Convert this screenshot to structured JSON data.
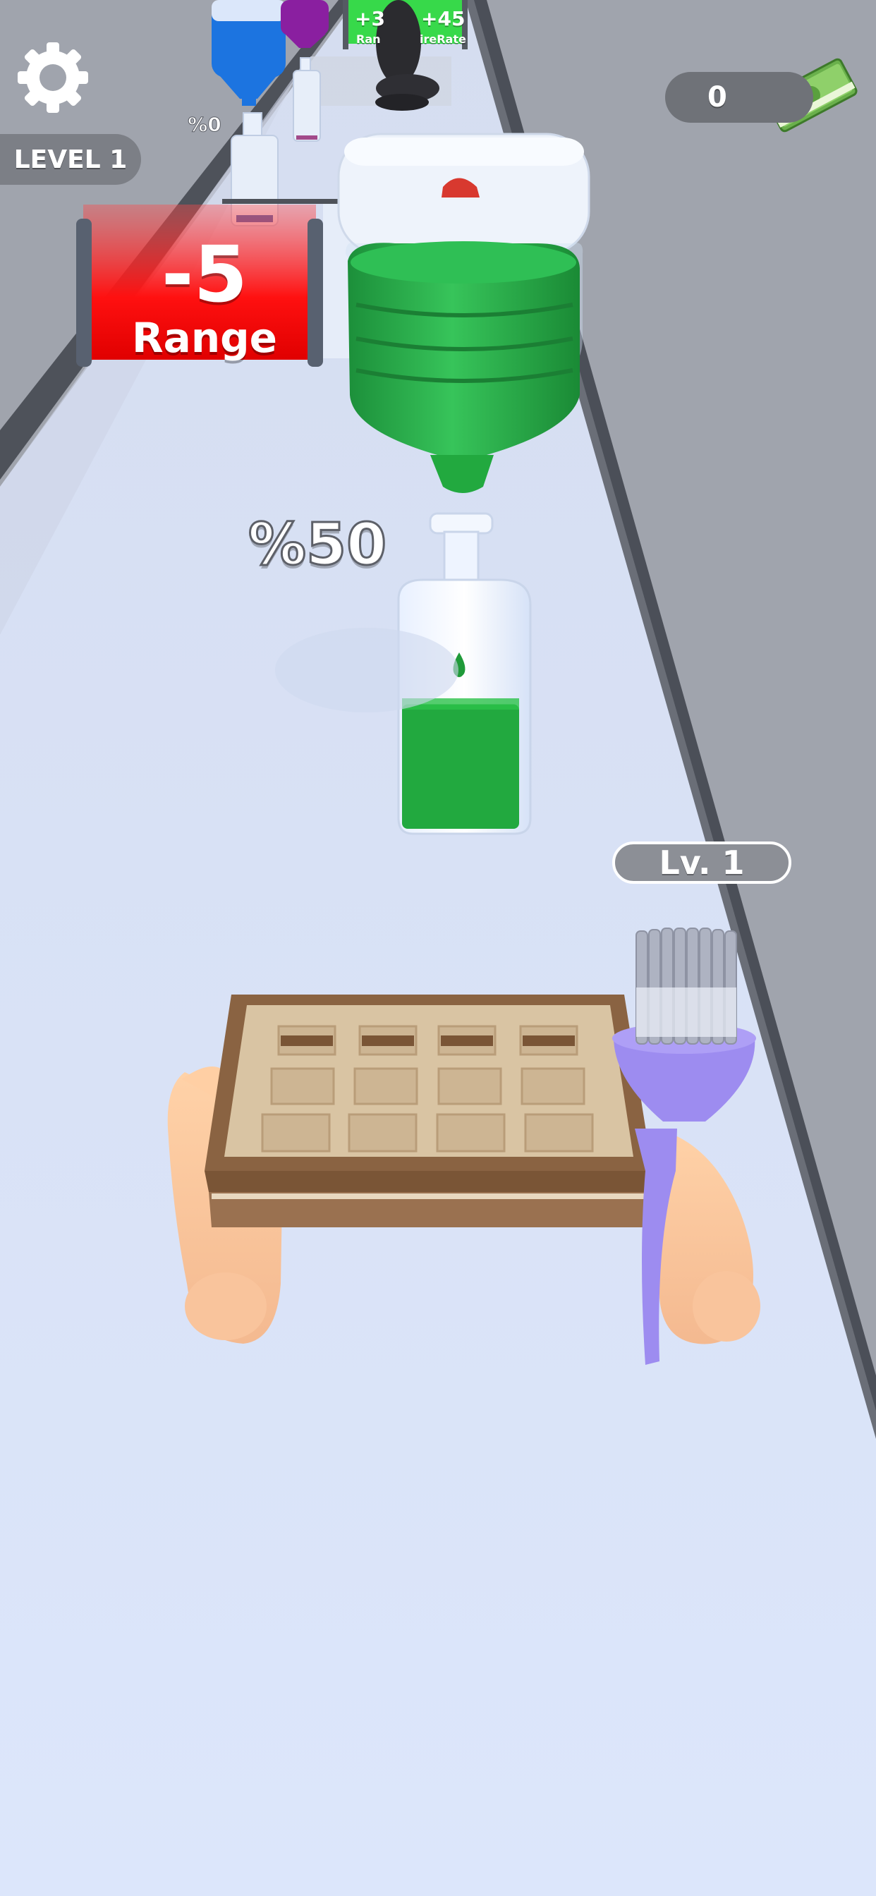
{
  "hud": {
    "level_label": "LEVEL 1",
    "money": "0",
    "settings_icon": "gear-icon",
    "money_icon": "cash-stack-icon"
  },
  "gates": {
    "near": {
      "value": "-5",
      "stat": "Range",
      "color": "#ff1a1a"
    },
    "far_left": {
      "value": "+3",
      "stat": "Ran"
    },
    "far_right": {
      "value": "+45",
      "stat": "ireRate",
      "color": "#37d94a"
    }
  },
  "bottles": {
    "near_fill_text": "%50",
    "near_fill_percent": 50,
    "far_fill_text": "%0",
    "far_fill_percent": 0,
    "liquid_color": "#22a93f"
  },
  "jugs": [
    {
      "color": "#1c74e0"
    },
    {
      "color": "#8a1fa0"
    },
    {
      "color": "#1fa34a"
    }
  ],
  "player": {
    "level_label": "Lv. 1",
    "brush_color": "#9d8cf0",
    "tray_color": "#8a6342"
  },
  "colors": {
    "road": "#dde6fb",
    "rail": "#4a4e57",
    "sky": "#9ea3ad"
  }
}
